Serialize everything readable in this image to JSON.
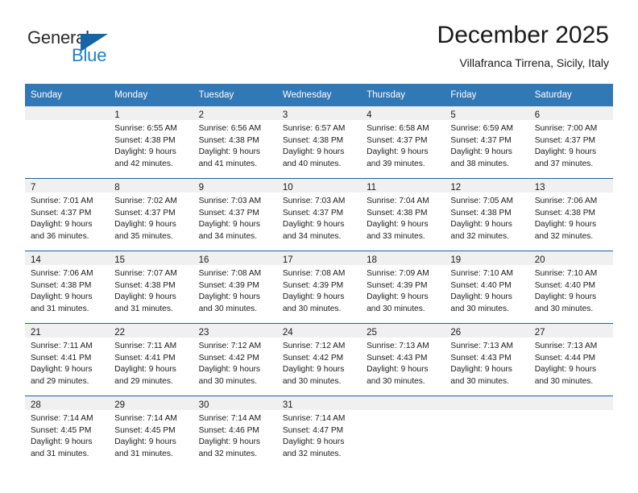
{
  "brand": {
    "line1": "General",
    "line2": "Blue",
    "triangle_color": "#1565a8",
    "blue_text_color": "#1f7fc4"
  },
  "header": {
    "title": "December 2025",
    "subtitle": "Villafranca Tirrena, Sicily, Italy"
  },
  "theme": {
    "header_bg": "#3178b6",
    "row_divider": "#205f9e",
    "daynum_band": "#f0f0f0",
    "text": "#1a1a1a"
  },
  "weekdays": [
    "Sunday",
    "Monday",
    "Tuesday",
    "Wednesday",
    "Thursday",
    "Friday",
    "Saturday"
  ],
  "weeks": [
    [
      {
        "day": "",
        "lines": []
      },
      {
        "day": "1",
        "lines": [
          "Sunrise: 6:55 AM",
          "Sunset: 4:38 PM",
          "Daylight: 9 hours",
          "and 42 minutes."
        ]
      },
      {
        "day": "2",
        "lines": [
          "Sunrise: 6:56 AM",
          "Sunset: 4:38 PM",
          "Daylight: 9 hours",
          "and 41 minutes."
        ]
      },
      {
        "day": "3",
        "lines": [
          "Sunrise: 6:57 AM",
          "Sunset: 4:38 PM",
          "Daylight: 9 hours",
          "and 40 minutes."
        ]
      },
      {
        "day": "4",
        "lines": [
          "Sunrise: 6:58 AM",
          "Sunset: 4:37 PM",
          "Daylight: 9 hours",
          "and 39 minutes."
        ]
      },
      {
        "day": "5",
        "lines": [
          "Sunrise: 6:59 AM",
          "Sunset: 4:37 PM",
          "Daylight: 9 hours",
          "and 38 minutes."
        ]
      },
      {
        "day": "6",
        "lines": [
          "Sunrise: 7:00 AM",
          "Sunset: 4:37 PM",
          "Daylight: 9 hours",
          "and 37 minutes."
        ]
      }
    ],
    [
      {
        "day": "7",
        "lines": [
          "Sunrise: 7:01 AM",
          "Sunset: 4:37 PM",
          "Daylight: 9 hours",
          "and 36 minutes."
        ]
      },
      {
        "day": "8",
        "lines": [
          "Sunrise: 7:02 AM",
          "Sunset: 4:37 PM",
          "Daylight: 9 hours",
          "and 35 minutes."
        ]
      },
      {
        "day": "9",
        "lines": [
          "Sunrise: 7:03 AM",
          "Sunset: 4:37 PM",
          "Daylight: 9 hours",
          "and 34 minutes."
        ]
      },
      {
        "day": "10",
        "lines": [
          "Sunrise: 7:03 AM",
          "Sunset: 4:37 PM",
          "Daylight: 9 hours",
          "and 34 minutes."
        ]
      },
      {
        "day": "11",
        "lines": [
          "Sunrise: 7:04 AM",
          "Sunset: 4:38 PM",
          "Daylight: 9 hours",
          "and 33 minutes."
        ]
      },
      {
        "day": "12",
        "lines": [
          "Sunrise: 7:05 AM",
          "Sunset: 4:38 PM",
          "Daylight: 9 hours",
          "and 32 minutes."
        ]
      },
      {
        "day": "13",
        "lines": [
          "Sunrise: 7:06 AM",
          "Sunset: 4:38 PM",
          "Daylight: 9 hours",
          "and 32 minutes."
        ]
      }
    ],
    [
      {
        "day": "14",
        "lines": [
          "Sunrise: 7:06 AM",
          "Sunset: 4:38 PM",
          "Daylight: 9 hours",
          "and 31 minutes."
        ]
      },
      {
        "day": "15",
        "lines": [
          "Sunrise: 7:07 AM",
          "Sunset: 4:38 PM",
          "Daylight: 9 hours",
          "and 31 minutes."
        ]
      },
      {
        "day": "16",
        "lines": [
          "Sunrise: 7:08 AM",
          "Sunset: 4:39 PM",
          "Daylight: 9 hours",
          "and 30 minutes."
        ]
      },
      {
        "day": "17",
        "lines": [
          "Sunrise: 7:08 AM",
          "Sunset: 4:39 PM",
          "Daylight: 9 hours",
          "and 30 minutes."
        ]
      },
      {
        "day": "18",
        "lines": [
          "Sunrise: 7:09 AM",
          "Sunset: 4:39 PM",
          "Daylight: 9 hours",
          "and 30 minutes."
        ]
      },
      {
        "day": "19",
        "lines": [
          "Sunrise: 7:10 AM",
          "Sunset: 4:40 PM",
          "Daylight: 9 hours",
          "and 30 minutes."
        ]
      },
      {
        "day": "20",
        "lines": [
          "Sunrise: 7:10 AM",
          "Sunset: 4:40 PM",
          "Daylight: 9 hours",
          "and 30 minutes."
        ]
      }
    ],
    [
      {
        "day": "21",
        "lines": [
          "Sunrise: 7:11 AM",
          "Sunset: 4:41 PM",
          "Daylight: 9 hours",
          "and 29 minutes."
        ]
      },
      {
        "day": "22",
        "lines": [
          "Sunrise: 7:11 AM",
          "Sunset: 4:41 PM",
          "Daylight: 9 hours",
          "and 29 minutes."
        ]
      },
      {
        "day": "23",
        "lines": [
          "Sunrise: 7:12 AM",
          "Sunset: 4:42 PM",
          "Daylight: 9 hours",
          "and 30 minutes."
        ]
      },
      {
        "day": "24",
        "lines": [
          "Sunrise: 7:12 AM",
          "Sunset: 4:42 PM",
          "Daylight: 9 hours",
          "and 30 minutes."
        ]
      },
      {
        "day": "25",
        "lines": [
          "Sunrise: 7:13 AM",
          "Sunset: 4:43 PM",
          "Daylight: 9 hours",
          "and 30 minutes."
        ]
      },
      {
        "day": "26",
        "lines": [
          "Sunrise: 7:13 AM",
          "Sunset: 4:43 PM",
          "Daylight: 9 hours",
          "and 30 minutes."
        ]
      },
      {
        "day": "27",
        "lines": [
          "Sunrise: 7:13 AM",
          "Sunset: 4:44 PM",
          "Daylight: 9 hours",
          "and 30 minutes."
        ]
      }
    ],
    [
      {
        "day": "28",
        "lines": [
          "Sunrise: 7:14 AM",
          "Sunset: 4:45 PM",
          "Daylight: 9 hours",
          "and 31 minutes."
        ]
      },
      {
        "day": "29",
        "lines": [
          "Sunrise: 7:14 AM",
          "Sunset: 4:45 PM",
          "Daylight: 9 hours",
          "and 31 minutes."
        ]
      },
      {
        "day": "30",
        "lines": [
          "Sunrise: 7:14 AM",
          "Sunset: 4:46 PM",
          "Daylight: 9 hours",
          "and 32 minutes."
        ]
      },
      {
        "day": "31",
        "lines": [
          "Sunrise: 7:14 AM",
          "Sunset: 4:47 PM",
          "Daylight: 9 hours",
          "and 32 minutes."
        ]
      },
      {
        "day": "",
        "lines": []
      },
      {
        "day": "",
        "lines": []
      },
      {
        "day": "",
        "lines": []
      }
    ]
  ]
}
